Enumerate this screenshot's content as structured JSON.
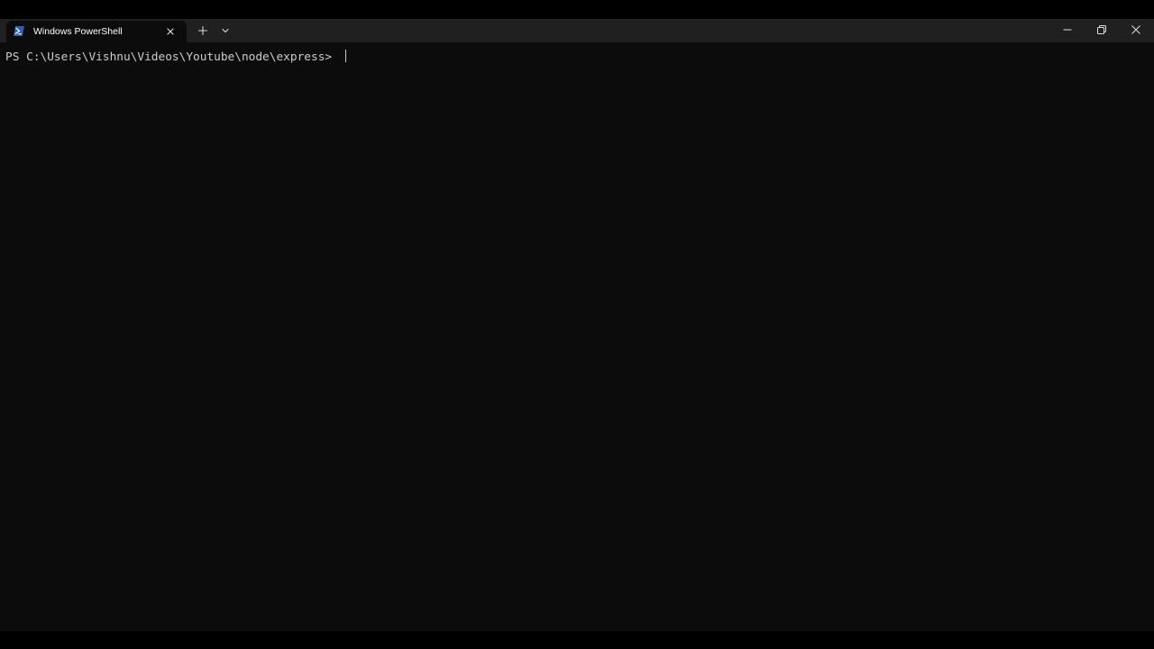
{
  "window": {
    "tab": {
      "title": "Windows PowerShell",
      "icon": "powershell-icon",
      "close_icon": "close-icon"
    },
    "new_tab_icon": "plus-icon",
    "dropdown_icon": "chevron-down-icon",
    "controls": {
      "minimize_icon": "minimize-icon",
      "maximize_icon": "restore-icon",
      "close_icon": "close-icon"
    }
  },
  "terminal": {
    "prompt": "PS C:\\Users\\Vishnu\\Videos\\Youtube\\node\\express> ",
    "input": ""
  },
  "colors": {
    "titlebar": "#202020",
    "terminal_bg": "#0c0c0c",
    "text": "#cccccc",
    "powershell_blue": "#2c5fb3"
  }
}
